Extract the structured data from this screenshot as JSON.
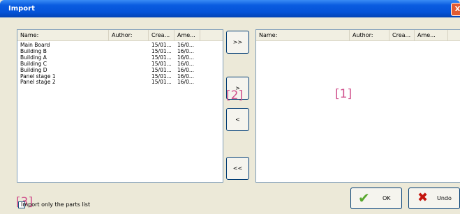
{
  "window": {
    "title": "Import",
    "close_glyph": "X"
  },
  "left_list": {
    "columns": [
      "Name:",
      "Author:",
      "Crea...",
      "Ame..."
    ],
    "rows": [
      [
        "Main Board",
        "",
        "15/01...",
        "16/0..."
      ],
      [
        "Building B",
        "",
        "15/01...",
        "16/0..."
      ],
      [
        "Building A",
        "",
        "15/01...",
        "16/0..."
      ],
      [
        "Building C",
        "",
        "15/01...",
        "16/0..."
      ],
      [
        "Building D",
        "",
        "15/01...",
        "16/0..."
      ],
      [
        "Panel stage 1",
        "",
        "15/01...",
        "16/0..."
      ],
      [
        "Panel stage 2",
        "",
        "15/01...",
        "16/0..."
      ]
    ]
  },
  "right_list": {
    "columns": [
      "Name:",
      "Author:",
      "Crea...",
      "Ame..."
    ],
    "rows": []
  },
  "move_buttons": {
    "add_all": ">>",
    "add": ">",
    "remove": "<",
    "remove_all": "<<"
  },
  "annotations": {
    "label1": "[1]",
    "label2": "[2]",
    "label3": "[3]"
  },
  "checkbox": {
    "label": "Import only the parts list",
    "checked": false
  },
  "buttons": {
    "ok": "OK",
    "undo": "Undo"
  },
  "icons": {
    "ok": "check-icon",
    "undo": "x-icon",
    "close": "close-icon"
  },
  "colors": {
    "title_bar": "#0553d8",
    "annotation": "#d0508c",
    "ok_check": "#58a72d",
    "undo_x": "#c4150d"
  }
}
